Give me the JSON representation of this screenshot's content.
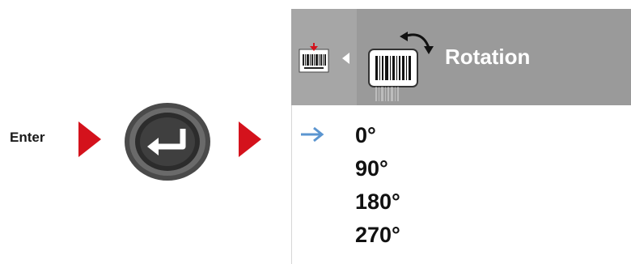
{
  "flow": {
    "enter_label": "Enter",
    "enter_key_icon": "enter-key-icon",
    "pointer_color": "#d4121c"
  },
  "menu": {
    "title": "Rotation",
    "header_color": "#9a9a9a",
    "small_barcode_icon": "barcode-label-icon",
    "back_icon": "back-arrow-icon",
    "rotation_icon": "barcode-rotate-icon",
    "options": [
      {
        "label": "0°",
        "selected": true
      },
      {
        "label": "90°",
        "selected": false
      },
      {
        "label": "180°",
        "selected": false
      },
      {
        "label": "270°",
        "selected": false
      }
    ],
    "selection_arrow_color": "#5b95d0"
  }
}
